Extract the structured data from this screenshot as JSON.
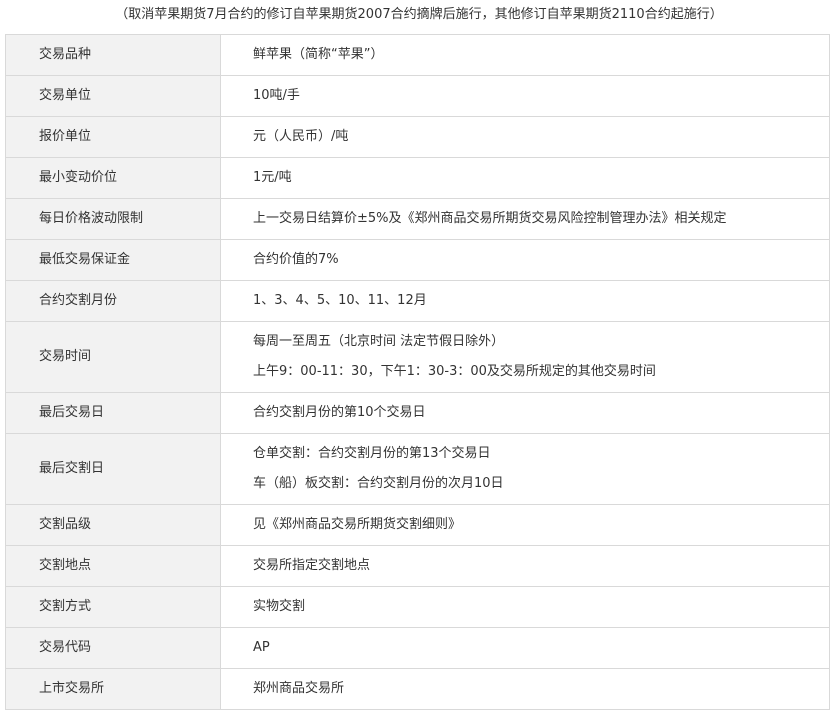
{
  "note": "（取消苹果期货7月合约的修订自苹果期货2007合约摘牌后施行，其他修订自苹果期货2110合约起施行）",
  "rows": [
    {
      "label": "交易品种",
      "values": [
        "鲜苹果（简称“苹果”）"
      ]
    },
    {
      "label": "交易单位",
      "values": [
        "10吨/手"
      ]
    },
    {
      "label": "报价单位",
      "values": [
        "元（人民币）/吨"
      ]
    },
    {
      "label": "最小变动价位",
      "values": [
        "1元/吨"
      ]
    },
    {
      "label": "每日价格波动限制",
      "values": [
        "上一交易日结算价±5%及《郑州商品交易所期货交易风险控制管理办法》相关规定"
      ]
    },
    {
      "label": "最低交易保证金",
      "values": [
        "合约价值的7%"
      ]
    },
    {
      "label": "合约交割月份",
      "values": [
        "1、3、4、5、10、11、12月"
      ]
    },
    {
      "label": "交易时间",
      "values": [
        "每周一至周五（北京时间 法定节假日除外）",
        "上午9：00-11：30，下午1：30-3：00及交易所规定的其他交易时间"
      ]
    },
    {
      "label": "最后交易日",
      "values": [
        "合约交割月份的第10个交易日"
      ]
    },
    {
      "label": "最后交割日",
      "values": [
        "仓单交割：合约交割月份的第13个交易日",
        "车（船）板交割：合约交割月份的次月10日"
      ]
    },
    {
      "label": "交割品级",
      "values": [
        "见《郑州商品交易所期货交割细则》"
      ]
    },
    {
      "label": "交割地点",
      "values": [
        "交易所指定交割地点"
      ]
    },
    {
      "label": "交割方式",
      "values": [
        "实物交割"
      ]
    },
    {
      "label": "交易代码",
      "values": [
        "AP"
      ]
    },
    {
      "label": "上市交易所",
      "values": [
        "郑州商品交易所"
      ]
    }
  ]
}
